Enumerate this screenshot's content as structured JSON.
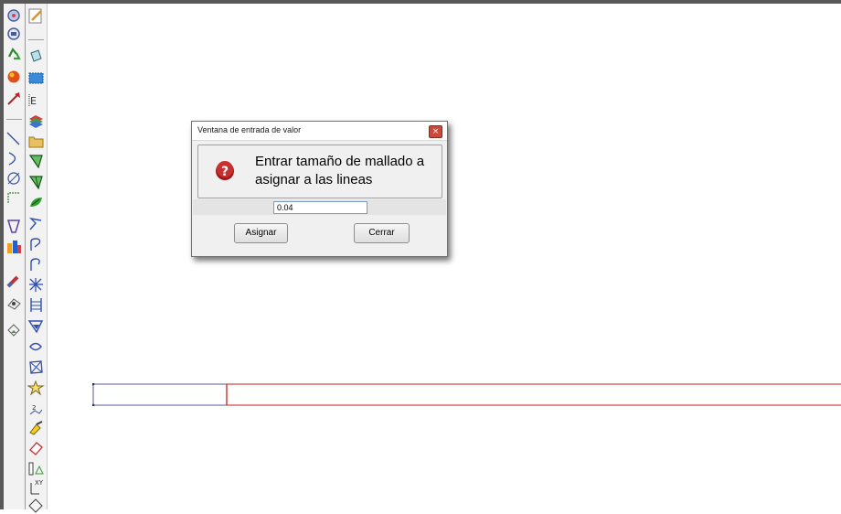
{
  "dialog": {
    "title": "Ventana de entrada de valor",
    "close_glyph": "×",
    "message": "Entrar tamaño de mallado a asignar a las lineas",
    "icon": "question-icon",
    "input_value": "0.04",
    "assign_label": "Asignar",
    "close_label": "Cerrar"
  },
  "toolbar_left": {
    "icons": [
      "zoom-icon",
      "display-icon",
      "recycle-icon",
      "render-sphere-icon",
      "arrow-icon",
      "line-icon",
      "arc-icon",
      "curve-icon",
      "nurbs-line-icon",
      "surface-icon",
      "color-icon",
      "magnet-icon",
      "node-icon",
      "eraser-icon"
    ]
  },
  "toolbar_right": {
    "icons": [
      "edit-icon",
      "layer-icon",
      "select-box-icon",
      "equation-icon",
      "layers-icon",
      "folder-icon",
      "surface-mesh-icon",
      "surface-mesh-icon",
      "leaf-icon",
      "path-icon",
      "loop-icon",
      "loop-icon",
      "explode-icon",
      "ladder-icon",
      "polygon-icon",
      "swap-icon",
      "net-icon",
      "star-icon",
      "sequence-icon",
      "brush-icon",
      "eraser-icon",
      "measure-icon",
      "xy-axis-icon",
      "diamond-icon"
    ]
  },
  "colors": {
    "line_blue": "#5a5aa0",
    "line_red": "#c81e1e",
    "accent": "#c94a3a"
  }
}
